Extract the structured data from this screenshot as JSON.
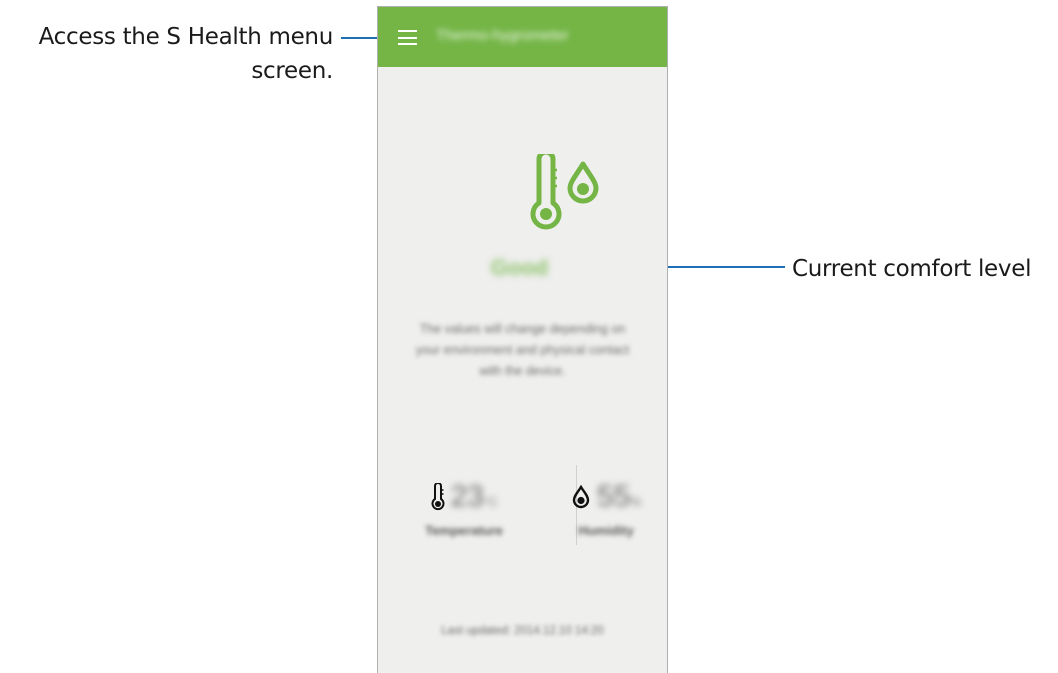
{
  "annotations": {
    "menu_callout": "Access the S Health menu screen.",
    "comfort_callout": "Current comfort level",
    "leader_color": "#1f6fb6"
  },
  "app": {
    "title": "Thermo-hygrometer",
    "accent_color": "#74b546",
    "hero_icon": "thermo-hygrometer-icon",
    "comfort_level": "Good",
    "description": "The values will change depending on your environment and physical contact with the device.",
    "temperature": {
      "icon": "thermometer-icon",
      "value": "23",
      "unit": "°C",
      "label": "Temperature"
    },
    "humidity": {
      "icon": "droplet-icon",
      "value": "55",
      "unit": "%",
      "label": "Humidity"
    },
    "last_updated": "Last updated: 2014.12.10 14:20"
  }
}
